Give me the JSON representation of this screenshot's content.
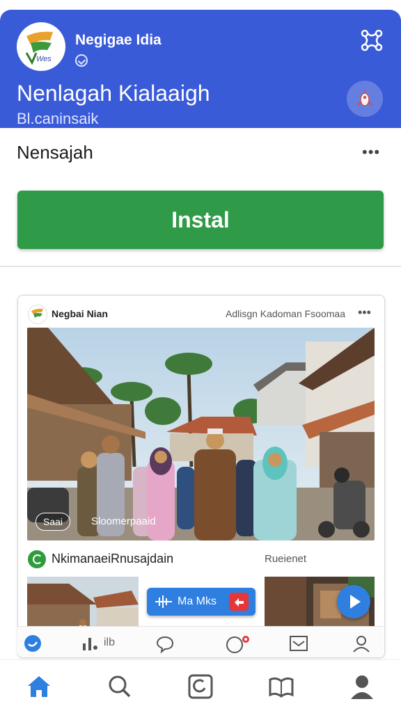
{
  "header": {
    "brand": "Negigae Idia",
    "title": "Nenlagah Kialaaigh",
    "subtitle": "Bl.caninsaik"
  },
  "app": {
    "name": "Nensajah",
    "install_label": "Instal"
  },
  "card": {
    "advertiser": "Negbai Nian",
    "ad_label": "Adlisgn Kadoman Fsoomaa",
    "photo_tag_left": "Saai",
    "photo_tag_right": "Sloomerpaaid",
    "brand_line": "NkimanaeiRnusajdain",
    "brand_line_right": "Rueienet",
    "pill_label": "Ma Mks"
  },
  "card_toolbar": {
    "stats_label": "ilb"
  },
  "icons": {
    "share": "share-icon",
    "rocket": "rocket-icon",
    "more": "more-icon",
    "play": "play-icon",
    "home": "home-icon",
    "search": "search-icon",
    "compass": "compass-icon",
    "book": "book-icon",
    "profile": "profile-icon"
  },
  "colors": {
    "header": "#3a5bd8",
    "install": "#2f9a48",
    "accent": "#2f7fe0"
  }
}
